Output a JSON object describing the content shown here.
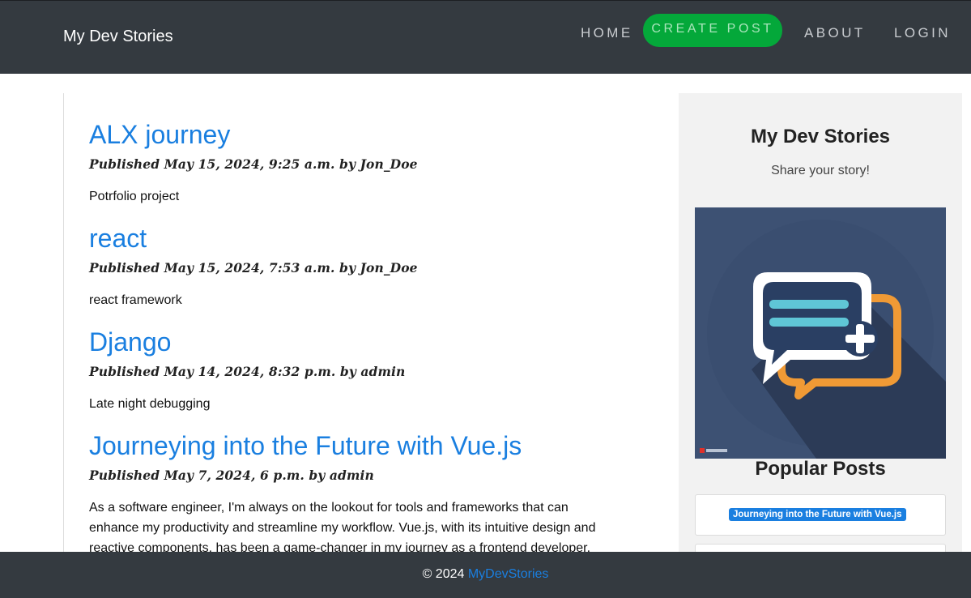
{
  "navbar": {
    "brand": "My Dev Stories",
    "links": {
      "home": "HOME",
      "create_post": "CREATE POST",
      "about": "ABOUT",
      "login": "LOGIN"
    },
    "colors": {
      "background": "#343a40",
      "create_button": "#04a83a"
    }
  },
  "posts": [
    {
      "title": "ALX journey",
      "meta": "Published May 15, 2024, 9:25 a.m. by Jon_Doe",
      "excerpt": "Potrfolio project"
    },
    {
      "title": "react",
      "meta": "Published May 15, 2024, 7:53 a.m. by Jon_Doe",
      "excerpt": "react framework"
    },
    {
      "title": "Django",
      "meta": "Published May 14, 2024, 8:32 p.m. by admin",
      "excerpt": "Late night debugging"
    },
    {
      "title": "Journeying into the Future with Vue.js",
      "meta": "Published May 7, 2024, 6 p.m. by admin",
      "excerpt": "As a software engineer, I'm always on the lookout for tools and frameworks that can enhance my productivity and streamline my workflow. Vue.js, with its intuitive design and reactive components, has been a game-changer in my journey as a frontend developer."
    }
  ],
  "sidebar": {
    "title": "My Dev Stories",
    "subtitle": "Share your story!",
    "image_icon": "chat-bubble-plus-icon",
    "popular_title": "Popular Posts",
    "popular": [
      {
        "label": "Journeying into the Future with Vue.js"
      }
    ]
  },
  "footer": {
    "copyright": "© 2024 ",
    "link": "MyDevStories"
  },
  "colors": {
    "link": "#1a7fe0",
    "sidebar_bg": "#f2f2f2"
  }
}
